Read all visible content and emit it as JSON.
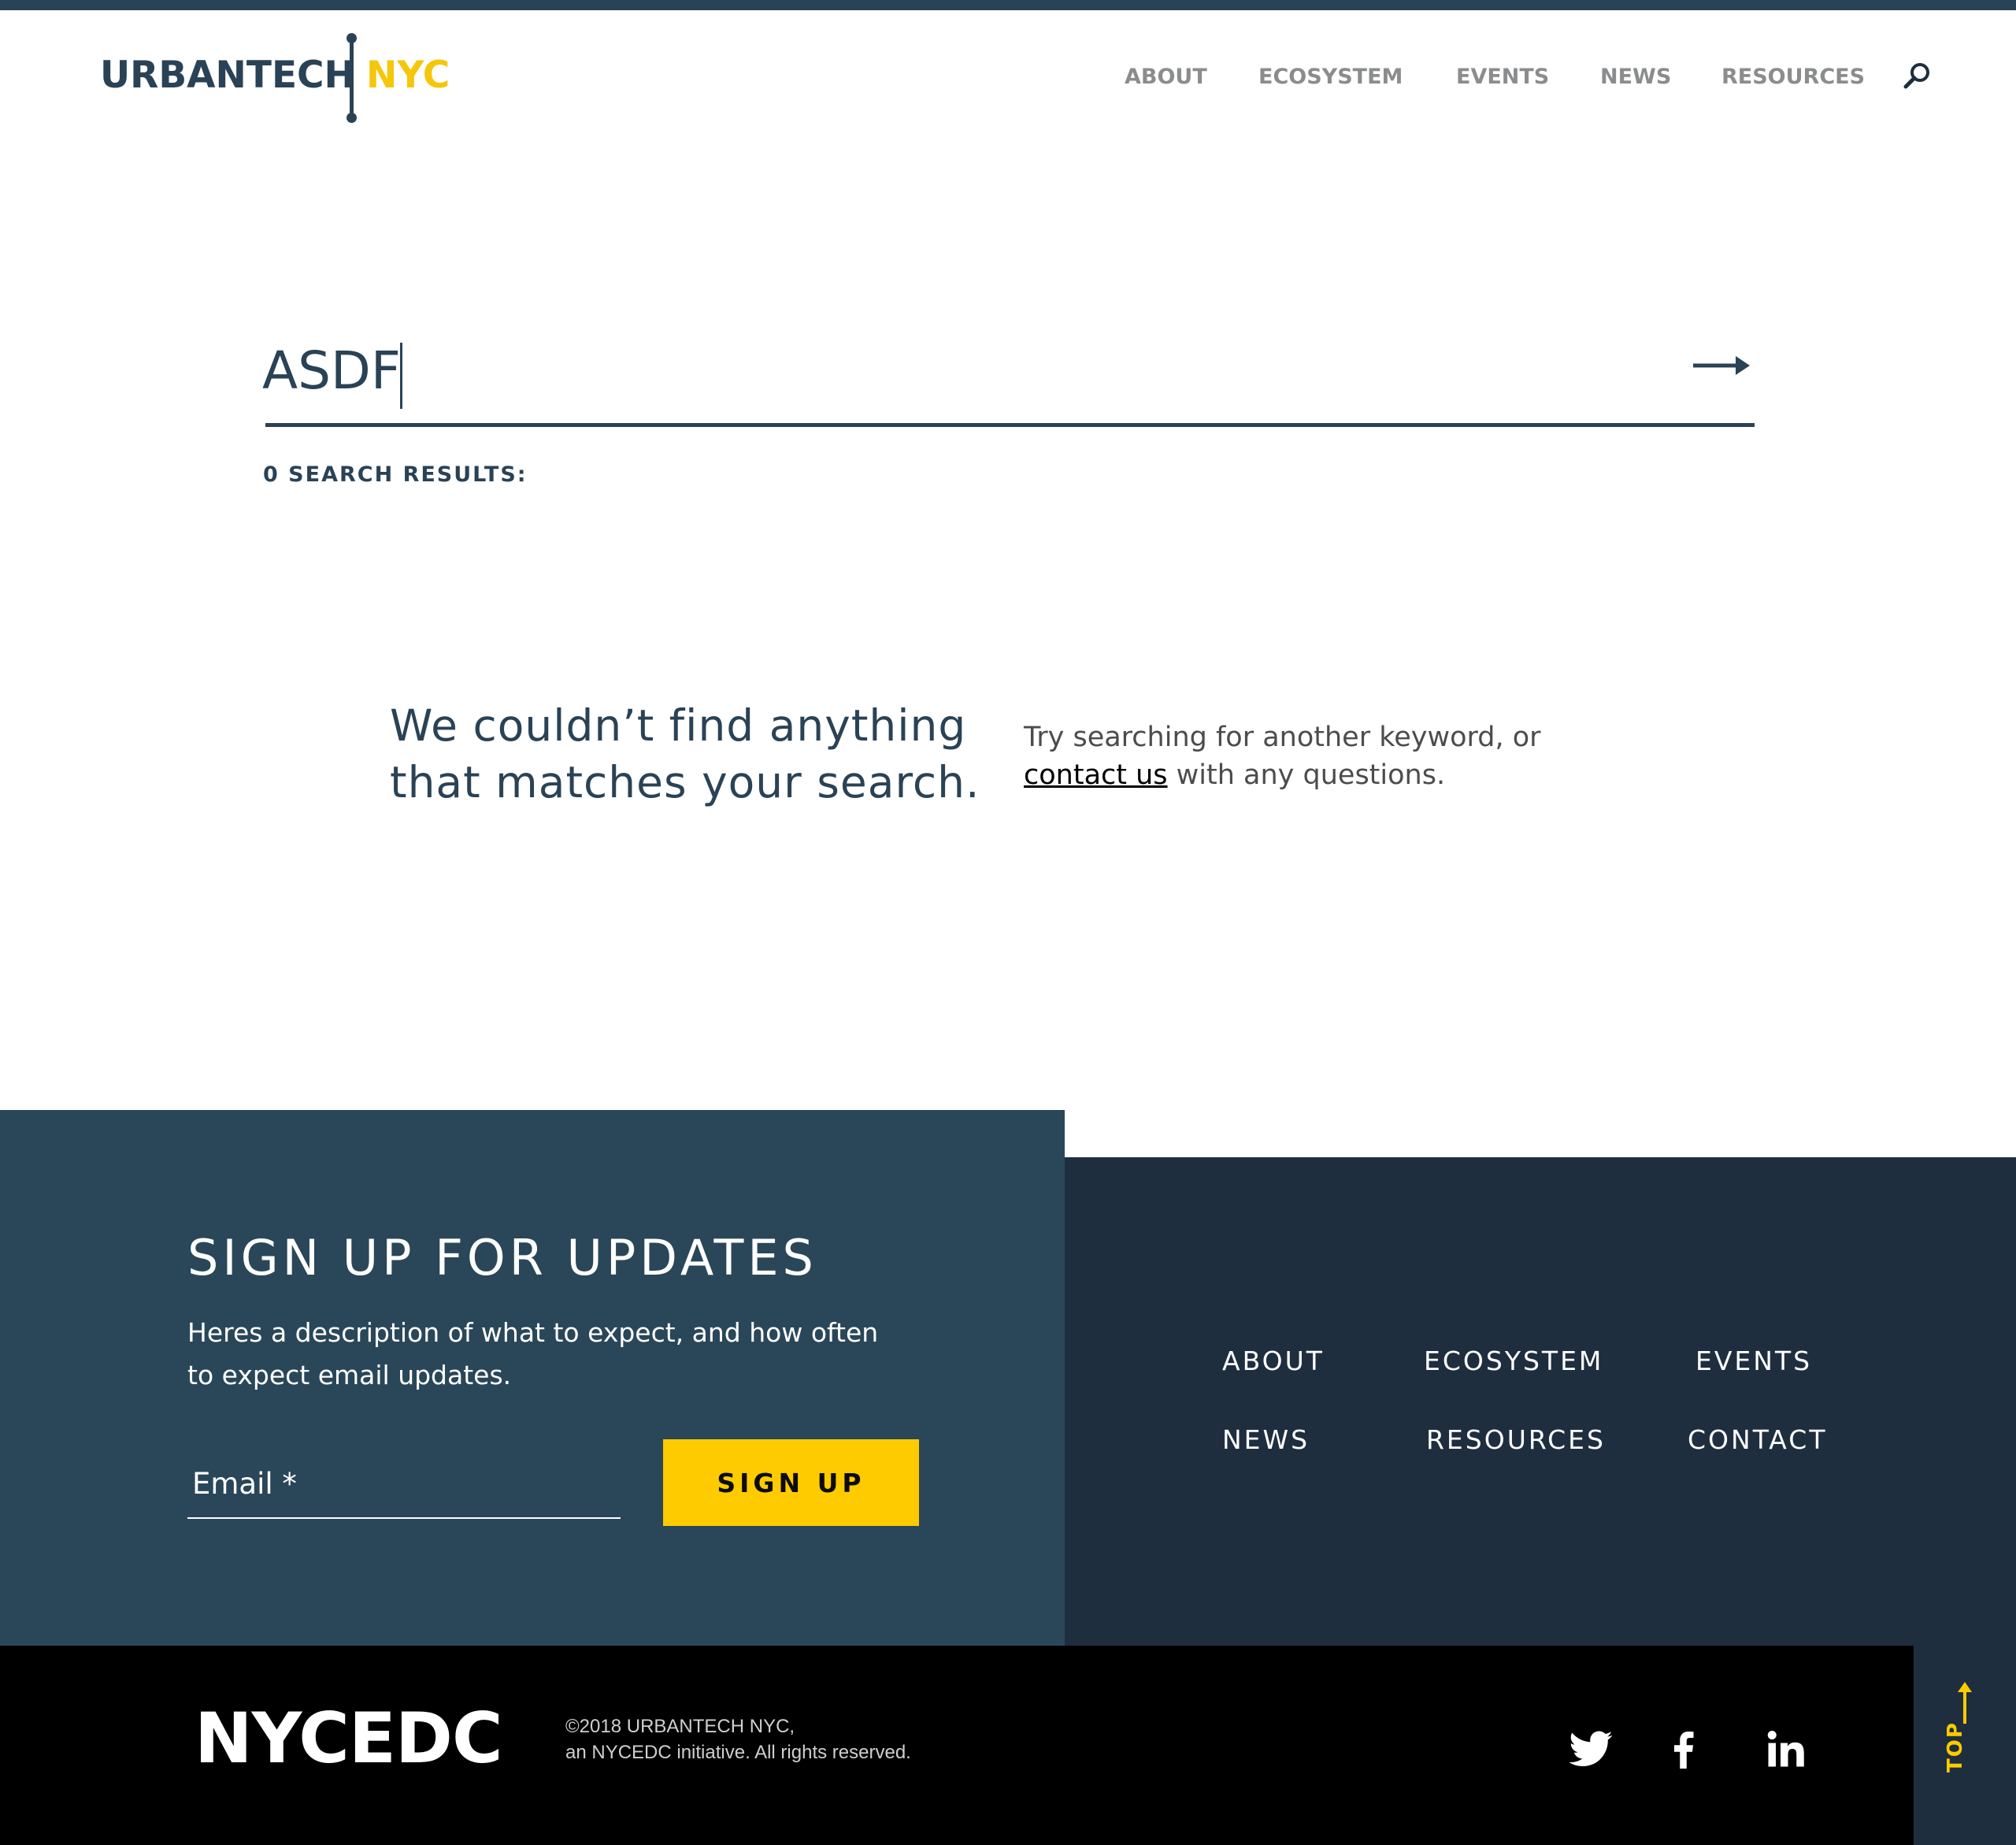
{
  "header": {
    "logo_left": "URBANTECH",
    "logo_right": "NYC",
    "nav": [
      "ABOUT",
      "ECOSYSTEM",
      "EVENTS",
      "NEWS",
      "RESOURCES"
    ],
    "search_icon": "search-icon"
  },
  "search": {
    "value": "ASDF",
    "submit_icon": "arrow-right-icon",
    "results_label": "0 SEARCH RESULTS:"
  },
  "no_results": {
    "title": "We couldn’t find anything that matches your search.",
    "text_before": "Try searching for another keyword, or ",
    "link": "contact us",
    "text_after": " with any questions."
  },
  "signup": {
    "title": "SIGN UP FOR UPDATES",
    "description": "Heres a description of what to expect, and how often to expect email updates.",
    "email_placeholder": "Email *",
    "button": "SIGN UP"
  },
  "footer_nav": [
    "ABOUT",
    "ECOSYSTEM",
    "EVENTS",
    "NEWS",
    "RESOURCES",
    "CONTACT"
  ],
  "bottom": {
    "brand": "NYCEDC",
    "copyright_line1": "©2018 URBANTECH NYC,",
    "copyright_line2": "an NYCEDC initiative. All rights reserved.",
    "social": [
      "twitter-icon",
      "facebook-icon",
      "linkedin-icon"
    ],
    "top_label": "TOP"
  },
  "colors": {
    "navy": "#2a4256",
    "yellow": "#fecb00",
    "footer_dark": "#1e2e3e",
    "signup_bg": "#2a4759"
  }
}
